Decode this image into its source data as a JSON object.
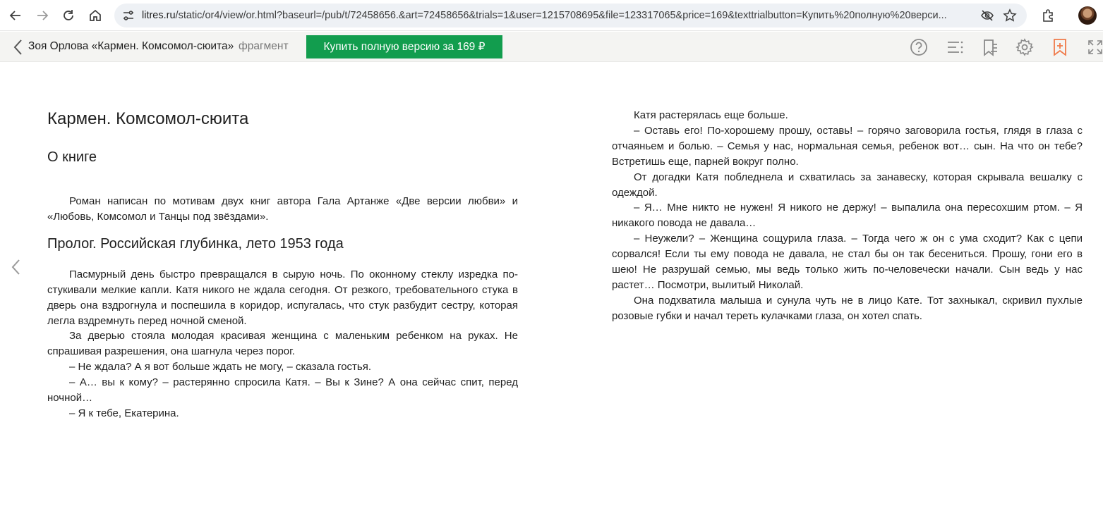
{
  "browser": {
    "url_host": "litres.ru",
    "url_path": "/static/or4/view/or.html?baseurl=/pub/t/72458656.&art=72458656&trials=1&user=1215708695&file=123317065&price=169&texttrialbutton=Купить%20полную%20верси..."
  },
  "reader": {
    "book_title": "Зоя Орлова «Кармен. Комсомол-сюита»",
    "fragment_label": "фрагмент",
    "buy_label": "Купить полную версию за 169 ₽"
  },
  "page_left": {
    "title": "Кармен. Комсомол-сюита",
    "about_heading": "О книге",
    "about_text": "Роман написан по мотивам двух книг автора Гала Артанже «Две версии любви» и «Любовь, Комсомол и Танцы под звёздами».",
    "prologue_heading": "Пролог. Российская глубинка, лето 1953 года",
    "paragraphs": [
      "Пасмурный день быстро превращался в сырую ночь. По оконному стеклу изредка по­стукивали мелкие капли. Катя никого не ждала сегодня. От резкого, требовательного стука в дверь она вздрогнула и поспешила в коридор, испугалась, что стук разбудит сестру, ко­торая легла вздремнуть перед ночной сменой.",
      "За дверью стояла молодая красивая женщина с маленьким ребенком на руках. Не спрашивая разрешения, она шагнула через порог.",
      "– Не ждала? А я вот больше ждать не могу, – сказала гостья.",
      "– А… вы к кому? – растерянно спросила Катя. – Вы к Зине? А она сейчас спит, перед ночной…",
      "– Я к тебе, Екатерина."
    ]
  },
  "page_right": {
    "paragraphs": [
      "Катя растерялась еще больше.",
      "– Оставь его! По-хорошему прошу, оставь! – горячо заговорила гостья, глядя в глаза с отчаяньем и болью. – Семья у нас, нормальная семья, ребенок вот… сын. На что он тебе? Встретишь еще, парней вокруг полно.",
      "От догадки Катя побледнела и схватилась за занавеску, которая скрывала вешалку с одеждой.",
      "– Я… Мне никто не нужен! Я никого не держу! – выпалила она пересохшим ртом. – Я никакого повода не давала…",
      "– Неужели? – Женщина сощурила глаза. – Тогда чего ж он с ума сходит? Как с цепи сорвался! Если ты ему повода не давала, не стал бы он так бесениться. Прошу, гони его в шею! Не разрушай семью, мы ведь только жить по-человечески начали. Сын ведь у нас растет… Посмотри, вылитый Николай.",
      "Она подхватила малыша и сунула чуть не в лицо Кате. Тот захныкал, скривил пухлые розовые губки и начал тереть кулачками глаза, он хотел спать."
    ]
  },
  "colors": {
    "buy_button": "#129d4e",
    "reader_bar": "#f4f4f2",
    "bookmark_accent": "#f07a4a"
  },
  "icons": {
    "browser": [
      "back-arrow-icon",
      "forward-arrow-icon",
      "reload-icon",
      "home-icon",
      "site-settings-icon",
      "eye-off-icon",
      "star-icon",
      "extensions-icon",
      "avatar"
    ],
    "reader": [
      "chevron-left-icon",
      "help-icon",
      "contents-icon",
      "bookmarks-list-icon",
      "settings-icon",
      "add-bookmark-icon",
      "fullscreen-icon",
      "prev-page-icon"
    ]
  }
}
